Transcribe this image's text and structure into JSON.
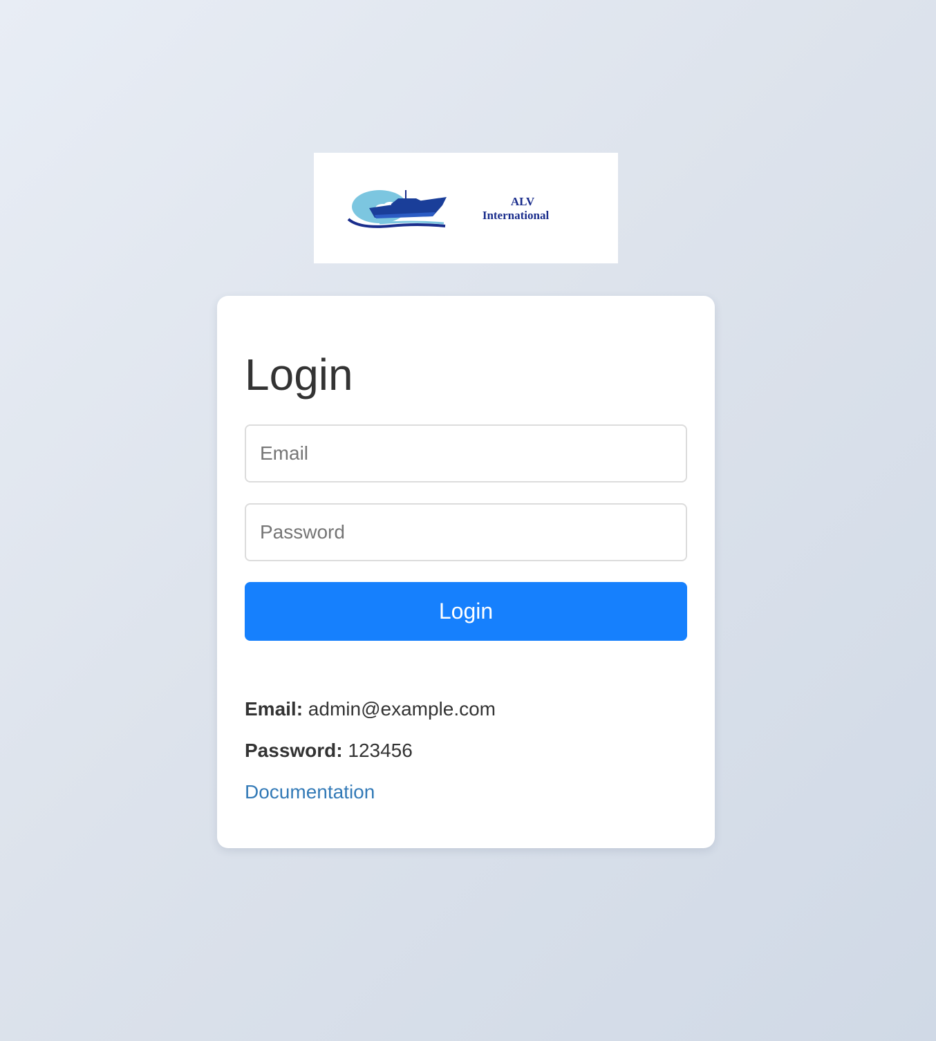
{
  "logo": {
    "line1": "ALV",
    "line2": "International",
    "alt": "ALV International logo"
  },
  "login": {
    "title": "Login",
    "email_placeholder": "Email",
    "password_placeholder": "Password",
    "button_label": "Login"
  },
  "credentials": {
    "email_label": "Email:",
    "email_value": " admin@example.com",
    "password_label": "Password:",
    "password_value": " 123456"
  },
  "links": {
    "documentation": "Documentation"
  },
  "colors": {
    "primary_button": "#1680fd",
    "link": "#337ab7",
    "logo_navy": "#1a2d8c",
    "logo_sky": "#7cc6e0"
  }
}
